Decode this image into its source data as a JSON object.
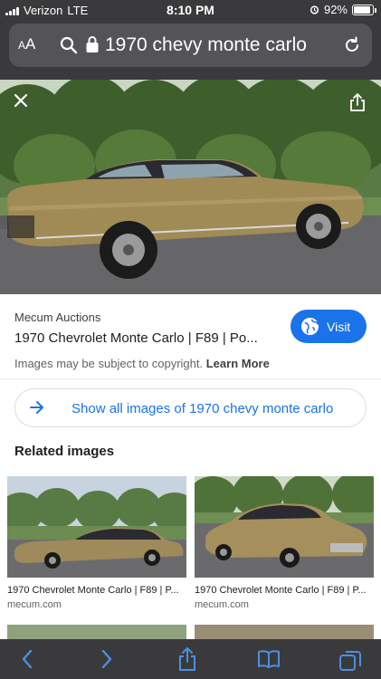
{
  "status_bar": {
    "carrier": "Verizon",
    "network": "LTE",
    "time": "8:10 PM",
    "battery": "92%",
    "battery_level": 0.92
  },
  "browser": {
    "text_size_label": "AA",
    "url_text": "1970 chevy monte carlo"
  },
  "image_viewer": {
    "close_icon": "close-icon",
    "share_icon": "share-icon"
  },
  "result": {
    "source": "Mecum Auctions",
    "title": "1970 Chevrolet Monte Carlo | F89 | Po...",
    "visit_label": "Visit",
    "copyright_text": "Images may be subject to copyright.",
    "learn_more": "Learn More",
    "show_all_label": "Show all images of 1970 chevy monte carlo"
  },
  "related": {
    "heading": "Related images",
    "items": [
      {
        "caption": "1970 Chevrolet Monte Carlo | F89 | P...",
        "domain": "mecum.com"
      },
      {
        "caption": "1970 Chevrolet Monte Carlo | F89 | P...",
        "domain": "mecum.com"
      }
    ]
  },
  "toolbar": {
    "icons": [
      "back-icon",
      "forward-icon",
      "share-icon",
      "bookmarks-icon",
      "tabs-icon"
    ]
  },
  "colors": {
    "accent": "#1a73e8",
    "chrome": "#3a3a3c",
    "toolbar_icon": "#4a90e2"
  }
}
